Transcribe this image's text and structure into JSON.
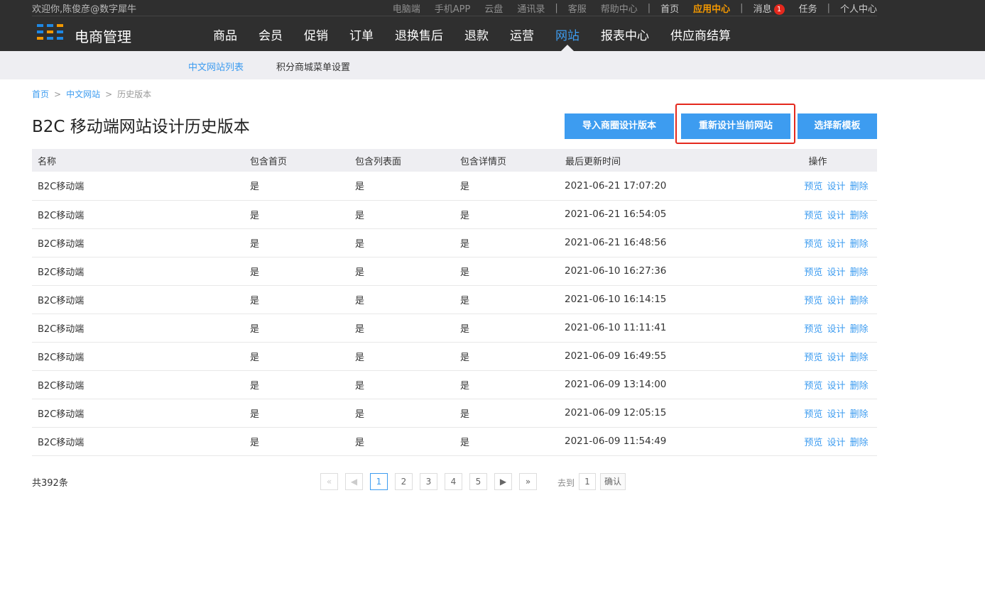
{
  "header": {
    "welcome": "欢迎你,陈俊彦@数字犀牛",
    "links": {
      "pc": "电脑端",
      "app": "手机APP",
      "cloud": "云盘",
      "contacts": "通讯录",
      "service": "客服",
      "help": "帮助中心",
      "home": "首页",
      "app_center": "应用中心",
      "messages": "消息",
      "message_count": "1",
      "tasks": "任务",
      "profile": "个人中心"
    },
    "brand": "电商管理",
    "nav": [
      "商品",
      "会员",
      "促销",
      "订单",
      "退换售后",
      "退款",
      "运营",
      "网站",
      "报表中心",
      "供应商结算"
    ],
    "active_nav": "网站"
  },
  "subnav": {
    "items": [
      "中文网站列表",
      "积分商城菜单设置"
    ]
  },
  "breadcrumb": [
    "首页",
    "中文网站",
    "历史版本"
  ],
  "breadcrumb_sep": ">",
  "page_title": "B2C 移动端网站设计历史版本",
  "buttons": {
    "import": "导入商圈设计版本",
    "redesign": "重新设计当前网站",
    "template": "选择新模板"
  },
  "table": {
    "columns": [
      "名称",
      "包含首页",
      "包含列表面",
      "包含详情页",
      "最后更新时间",
      "操作"
    ],
    "actions": [
      "预览",
      "设计",
      "删除"
    ],
    "rows": [
      {
        "name": "B2C移动端",
        "home": "是",
        "list": "是",
        "detail": "是",
        "updated": "2021-06-21 17:07:20"
      },
      {
        "name": "B2C移动端",
        "home": "是",
        "list": "是",
        "detail": "是",
        "updated": "2021-06-21 16:54:05"
      },
      {
        "name": "B2C移动端",
        "home": "是",
        "list": "是",
        "detail": "是",
        "updated": "2021-06-21 16:48:56"
      },
      {
        "name": "B2C移动端",
        "home": "是",
        "list": "是",
        "detail": "是",
        "updated": "2021-06-10 16:27:36"
      },
      {
        "name": "B2C移动端",
        "home": "是",
        "list": "是",
        "detail": "是",
        "updated": "2021-06-10 16:14:15"
      },
      {
        "name": "B2C移动端",
        "home": "是",
        "list": "是",
        "detail": "是",
        "updated": "2021-06-10 11:11:41"
      },
      {
        "name": "B2C移动端",
        "home": "是",
        "list": "是",
        "detail": "是",
        "updated": "2021-06-09 16:49:55"
      },
      {
        "name": "B2C移动端",
        "home": "是",
        "list": "是",
        "detail": "是",
        "updated": "2021-06-09 13:14:00"
      },
      {
        "name": "B2C移动端",
        "home": "是",
        "list": "是",
        "detail": "是",
        "updated": "2021-06-09 12:05:15"
      },
      {
        "name": "B2C移动端",
        "home": "是",
        "list": "是",
        "detail": "是",
        "updated": "2021-06-09 11:54:49"
      }
    ]
  },
  "pagination": {
    "total": "共392条",
    "first": "«",
    "prev": "◀",
    "pages": [
      "1",
      "2",
      "3",
      "4",
      "5"
    ],
    "current": "1",
    "next": "▶",
    "last": "»",
    "goto_label": "去到",
    "goto_value": "1",
    "confirm": "确认"
  },
  "colors": {
    "accent": "#3d9cf0",
    "header_bg": "#2f2f2f",
    "highlight": "#e4281d",
    "app_center": "#f39800"
  }
}
